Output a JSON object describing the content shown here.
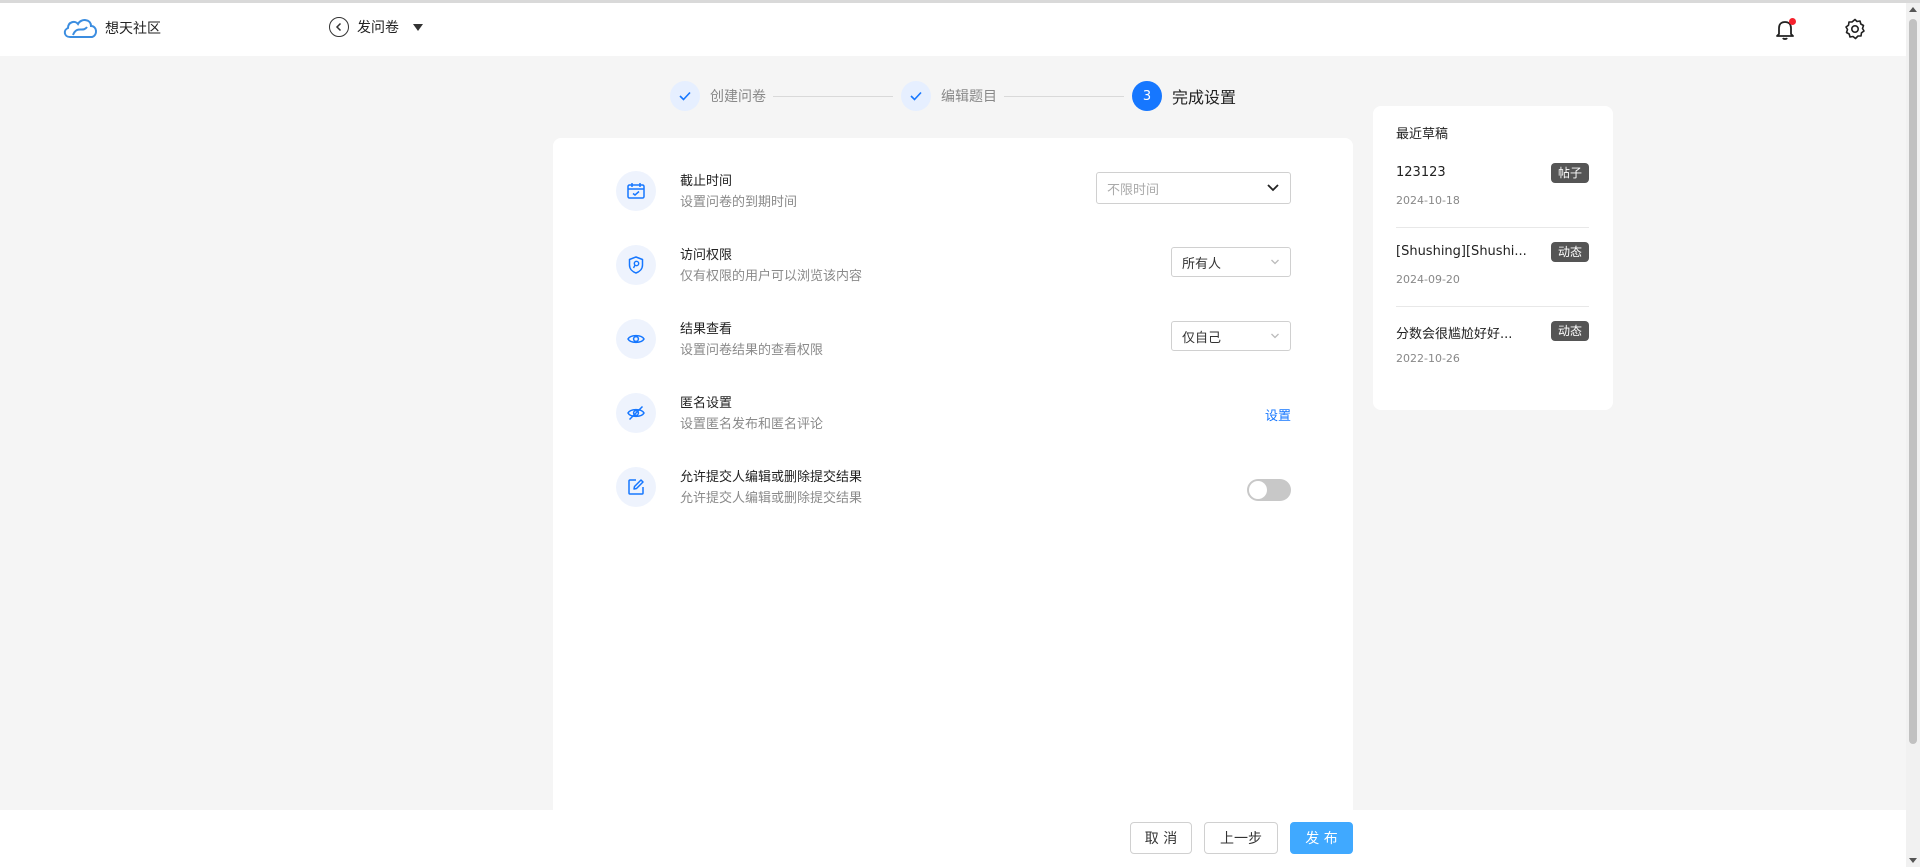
{
  "app": {
    "name": "想天社区"
  },
  "header": {
    "back_label": "发问卷"
  },
  "steps": [
    {
      "label": "创建问卷",
      "state": "done"
    },
    {
      "label": "编辑题目",
      "state": "done"
    },
    {
      "number": "3",
      "label": "完成设置",
      "state": "active"
    }
  ],
  "settings": {
    "deadline": {
      "title": "截止时间",
      "desc": "设置问卷的到期时间",
      "value": "不限时间"
    },
    "access": {
      "title": "访问权限",
      "desc": "仅有权限的用户可以浏览该内容",
      "value": "所有人"
    },
    "results": {
      "title": "结果查看",
      "desc": "设置问卷结果的查看权限",
      "value": "仅自己"
    },
    "anonymous": {
      "title": "匿名设置",
      "desc": "设置匿名发布和匿名评论",
      "action": "设置"
    },
    "edit_permission": {
      "title": "允许提交人编辑或删除提交结果",
      "desc": "允许提交人编辑或删除提交结果",
      "enabled": false
    }
  },
  "drafts": {
    "title": "最近草稿",
    "items": [
      {
        "title": "123123",
        "date": "2024-10-18",
        "tag": "帖子"
      },
      {
        "title": "[Shushing][Shushi...",
        "date": "2024-09-20",
        "tag": "动态"
      },
      {
        "title": "分数会很尴尬好好...",
        "date": "2022-10-26",
        "tag": "动态"
      }
    ]
  },
  "footer": {
    "cancel": "取 消",
    "prev": "上一步",
    "publish": "发 布"
  },
  "colors": {
    "primary": "#1677ff",
    "publish": "#40a9ff",
    "notification_dot": "#f5222d"
  }
}
